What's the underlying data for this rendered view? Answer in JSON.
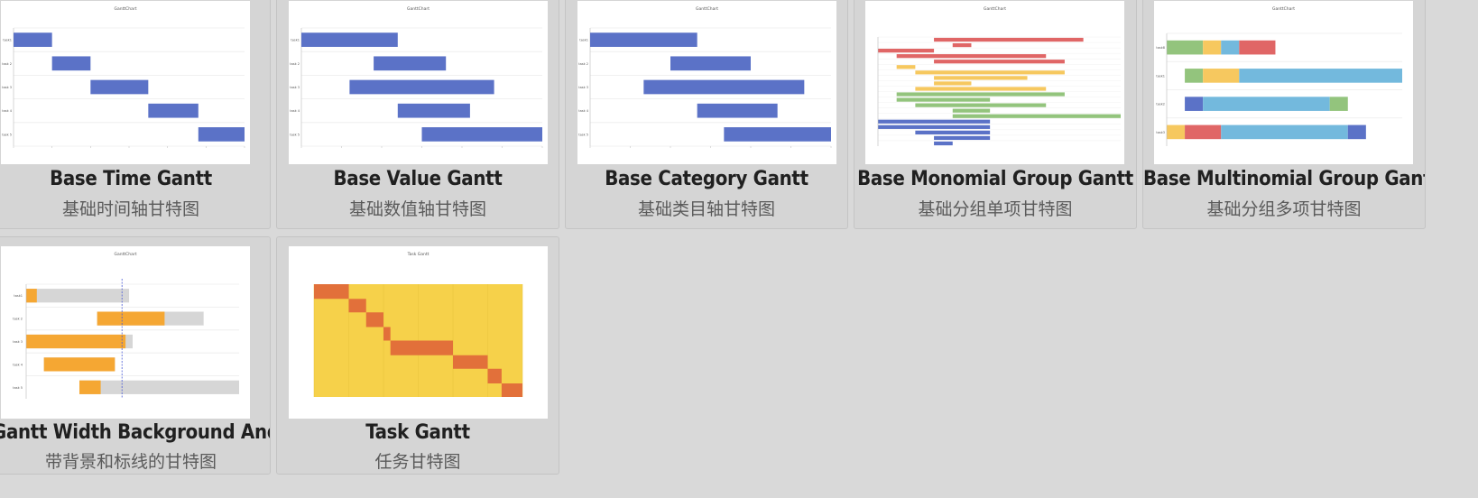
{
  "cards": [
    {
      "title": "Base Time Gantt",
      "subtitle": "基础时间轴甘特图",
      "chart_data": {
        "type": "bar",
        "title": "GanttChart",
        "categories": [
          "task1",
          "task 2",
          "task 3",
          "task 4",
          "task 5"
        ],
        "series": [
          {
            "values": [
              [
                0,
                1
              ],
              [
                1,
                2
              ],
              [
                2,
                3.5
              ],
              [
                3.5,
                4.8
              ],
              [
                4.8,
                6
              ]
            ]
          }
        ],
        "xlim": [
          0,
          6
        ],
        "color": "#5b72c7"
      }
    },
    {
      "title": "Base Value Gantt",
      "subtitle": "基础数值轴甘特图",
      "chart_data": {
        "type": "bar",
        "title": "GanttChart",
        "categories": [
          "task1",
          "task 2",
          "task 3",
          "task 4",
          "task 5"
        ],
        "series": [
          {
            "values": [
              [
                0,
                4
              ],
              [
                3,
                6
              ],
              [
                2,
                8
              ],
              [
                4,
                7
              ],
              [
                5,
                10
              ]
            ]
          }
        ],
        "xlim": [
          0,
          10
        ],
        "color": "#5b72c7"
      }
    },
    {
      "title": "Base Category Gantt",
      "subtitle": "基础类目轴甘特图",
      "chart_data": {
        "type": "bar",
        "title": "GanttChart",
        "categories": [
          "task1",
          "task 2",
          "task 3",
          "task 4",
          "task 5"
        ],
        "series": [
          {
            "values": [
              [
                0,
                4
              ],
              [
                3,
                6
              ],
              [
                2,
                8
              ],
              [
                4,
                7
              ],
              [
                5,
                9
              ]
            ]
          }
        ],
        "xlim": [
          0,
          9
        ],
        "color": "#5b72c7"
      }
    },
    {
      "title": "Base Monomial Group Gantt",
      "subtitle": "基础分组单项甘特图",
      "chart_data": {
        "type": "bar",
        "title": "GanttChart",
        "groups": [
          {
            "color": "#e06666",
            "values": [
              [
                3,
                11
              ],
              [
                4,
                5
              ],
              [
                0,
                3
              ],
              [
                1,
                9
              ],
              [
                3,
                10
              ]
            ]
          },
          {
            "color": "#f6c85f",
            "values": [
              [
                1,
                2
              ],
              [
                2,
                10
              ],
              [
                3,
                8
              ],
              [
                3,
                5
              ],
              [
                2,
                9
              ]
            ]
          },
          {
            "color": "#93c47d",
            "values": [
              [
                1,
                10
              ],
              [
                1,
                6
              ],
              [
                2,
                9
              ],
              [
                4,
                6
              ],
              [
                4,
                13
              ]
            ]
          },
          {
            "color": "#5b72c7",
            "values": [
              [
                0,
                6
              ],
              [
                0,
                6
              ],
              [
                2,
                6
              ],
              [
                3,
                6
              ],
              [
                3,
                4
              ]
            ]
          }
        ],
        "xlim": [
          0,
          13
        ]
      }
    },
    {
      "title": "Base Multinomial Group Gantt",
      "subtitle": "基础分组多项甘特图",
      "chart_data": {
        "type": "bar",
        "title": "GanttChart",
        "categories": [
          "task8",
          "task1",
          "task2",
          "task3"
        ],
        "series": [
          {
            "values": [
              {
                "start": 0,
                "end": 2,
                "color": "#93c47d"
              },
              {
                "start": 2,
                "end": 3,
                "color": "#f6c85f"
              },
              {
                "start": 3,
                "end": 4,
                "color": "#73b9dd"
              },
              {
                "start": 4,
                "end": 6,
                "color": "#e06666"
              }
            ]
          },
          {
            "values": [
              {
                "start": 1,
                "end": 2,
                "color": "#93c47d"
              },
              {
                "start": 2,
                "end": 4,
                "color": "#f6c85f"
              },
              {
                "start": 4,
                "end": 13,
                "color": "#73b9dd"
              }
            ]
          },
          {
            "values": [
              {
                "start": 1,
                "end": 2,
                "color": "#5b72c7"
              },
              {
                "start": 2,
                "end": 9,
                "color": "#73b9dd"
              },
              {
                "start": 9,
                "end": 10,
                "color": "#93c47d"
              }
            ]
          },
          {
            "values": [
              {
                "start": 0,
                "end": 1,
                "color": "#f6c85f"
              },
              {
                "start": 1,
                "end": 3,
                "color": "#e06666"
              },
              {
                "start": 3,
                "end": 10,
                "color": "#73b9dd"
              },
              {
                "start": 10,
                "end": 11,
                "color": "#5b72c7"
              }
            ]
          }
        ],
        "xlim": [
          0,
          13
        ]
      }
    },
    {
      "title": "Gantt Width Background And",
      "subtitle": "带背景和标线的甘特图",
      "chart_data": {
        "type": "bar",
        "title": "GanttChart",
        "categories": [
          "task1",
          "task 2",
          "task 3",
          "task 4",
          "task 5"
        ],
        "series": [
          {
            "name": "",
            "values": [
              [
                0,
                0.3
              ],
              [
                2,
                3.9
              ],
              [
                0,
                2.8
              ],
              [
                0.5,
                2.5
              ],
              [
                1.5,
                2.1
              ]
            ]
          }
        ],
        "background": [
          [
            0,
            2.9
          ],
          [
            2,
            5
          ],
          [
            0,
            3
          ],
          [
            0.5,
            2.5
          ],
          [
            1.5,
            6
          ]
        ],
        "marker": 2.7,
        "xlim": [
          0,
          6
        ],
        "color": "#f5a733",
        "bg_color": "#d6d6d6",
        "marker_color": "#4a5bd6"
      }
    },
    {
      "title": "Task Gantt",
      "subtitle": "任务甘特图",
      "chart_data": {
        "type": "heatmap",
        "title": "Task Gantt",
        "rows": 4,
        "xlim": [
          0,
          6
        ],
        "cells": [
          [
            0,
            1,
            0,
            0.13
          ],
          [
            1,
            1.5,
            0.13,
            0.25
          ],
          [
            1.5,
            2,
            0.25,
            0.38
          ],
          [
            2,
            2.2,
            0.38,
            0.5
          ],
          [
            2.2,
            4,
            0.5,
            0.63
          ],
          [
            4,
            5,
            0.63,
            0.75
          ],
          [
            5,
            5.4,
            0.75,
            0.88
          ],
          [
            5.4,
            6,
            0.88,
            1
          ]
        ],
        "bg_color": "#f6d14a",
        "cell_color": "#e2703a"
      }
    }
  ]
}
